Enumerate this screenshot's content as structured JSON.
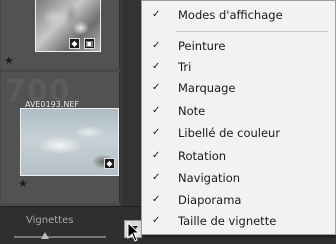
{
  "filmstrip": {
    "ghost_number": "700",
    "filename": "_AVE0193.NEF",
    "cell_1_rating_icon": "star-icon",
    "cell_2_rating_icon": "star-icon",
    "star_glyph": "★"
  },
  "bottom_bar": {
    "label": "Vignettes"
  },
  "menu": {
    "header": {
      "label": "Modes d'affichage",
      "checked": true
    },
    "items": [
      {
        "label": "Peinture",
        "checked": true
      },
      {
        "label": "Tri",
        "checked": true
      },
      {
        "label": "Marquage",
        "checked": true
      },
      {
        "label": "Note",
        "checked": true
      },
      {
        "label": "Libellé de couleur",
        "checked": true
      },
      {
        "label": "Rotation",
        "checked": true
      },
      {
        "label": "Navigation",
        "checked": true
      },
      {
        "label": "Diaporama",
        "checked": true
      },
      {
        "label": "Taille de vignette",
        "checked": true
      }
    ],
    "check_glyph": "✓"
  },
  "colors": {
    "menu_bg": "#f2f2f2",
    "panel_bg": "#4a4a4a",
    "bottom_bar_bg": "#2f2f2f"
  }
}
